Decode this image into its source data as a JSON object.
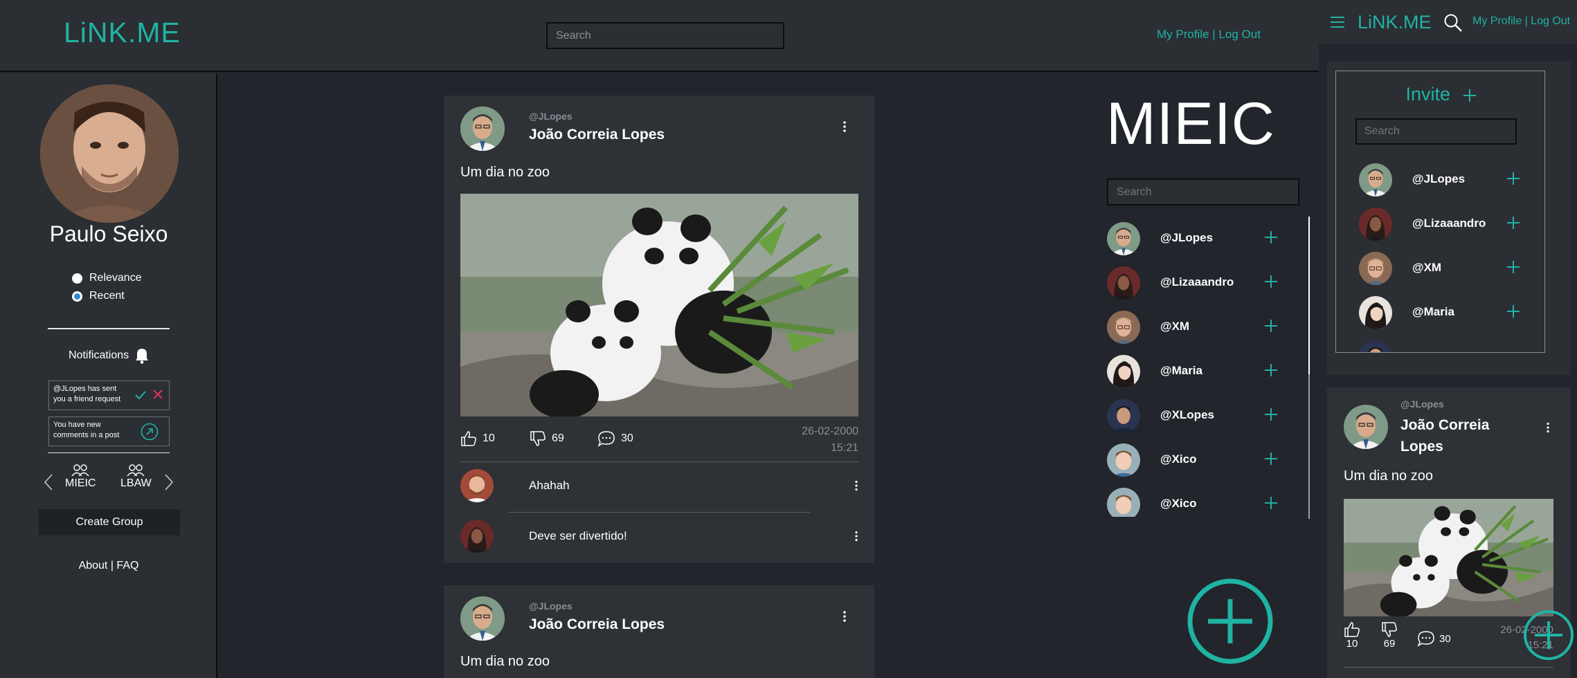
{
  "header": {
    "logo": "LiNK.ME",
    "search_placeholder": "Search",
    "links": "My Profile | Log Out"
  },
  "sidebar": {
    "user_name": "Paulo Seixo",
    "sort_options": [
      {
        "label": "Relevance",
        "selected": false
      },
      {
        "label": "Recent",
        "selected": true
      }
    ],
    "notifications_title": "Notifications",
    "notifications": [
      {
        "text_line1": "@JLopes has sent",
        "text_line2": "you a friend request"
      },
      {
        "text_line1": "You have new",
        "text_line2": "comments in a post"
      }
    ],
    "groups": [
      "MIEIC",
      "LBAW"
    ],
    "create_group_label": "Create Group",
    "footer_links": "About | FAQ"
  },
  "feed": {
    "posts": [
      {
        "handle": "@JLopes",
        "author": "João Correia Lopes",
        "text": "Um dia no zoo",
        "likes": "10",
        "dislikes": "69",
        "comments_count": "30",
        "date": "26-02-2000",
        "time": "15:21",
        "comments": [
          {
            "text": "Ahahah"
          },
          {
            "text": "Deve ser divertido!"
          }
        ]
      },
      {
        "handle": "@JLopes",
        "author": "João Correia Lopes",
        "text": "Um dia no zoo"
      }
    ]
  },
  "group": {
    "title": "MIEIC",
    "search_placeholder": "Search",
    "members": [
      "@JLopes",
      "@Lizaaandro",
      "@XM",
      "@Maria",
      "@XLopes",
      "@Xico",
      "@Xico"
    ]
  },
  "mobile": {
    "logo": "LiNK.ME",
    "links": "My Profile | Log Out",
    "invite_title": "Invite",
    "search_placeholder": "Search",
    "invite_members": [
      "@JLopes",
      "@Lizaaandro",
      "@XM",
      "@Maria"
    ],
    "post": {
      "handle": "@JLopes",
      "author_line1": "João Correia",
      "author_line2": "Lopes",
      "text": "Um dia no zoo",
      "likes": "10",
      "dislikes": "69",
      "comments_count": "30",
      "date": "26-02-2000",
      "time": "15:21"
    }
  },
  "colors": {
    "accent": "#1fb3a3",
    "background": "#22252b",
    "panel": "#2b2e33",
    "card": "#2e3136",
    "reject": "#e0325b",
    "radio_selected": "#2a8bd0"
  }
}
